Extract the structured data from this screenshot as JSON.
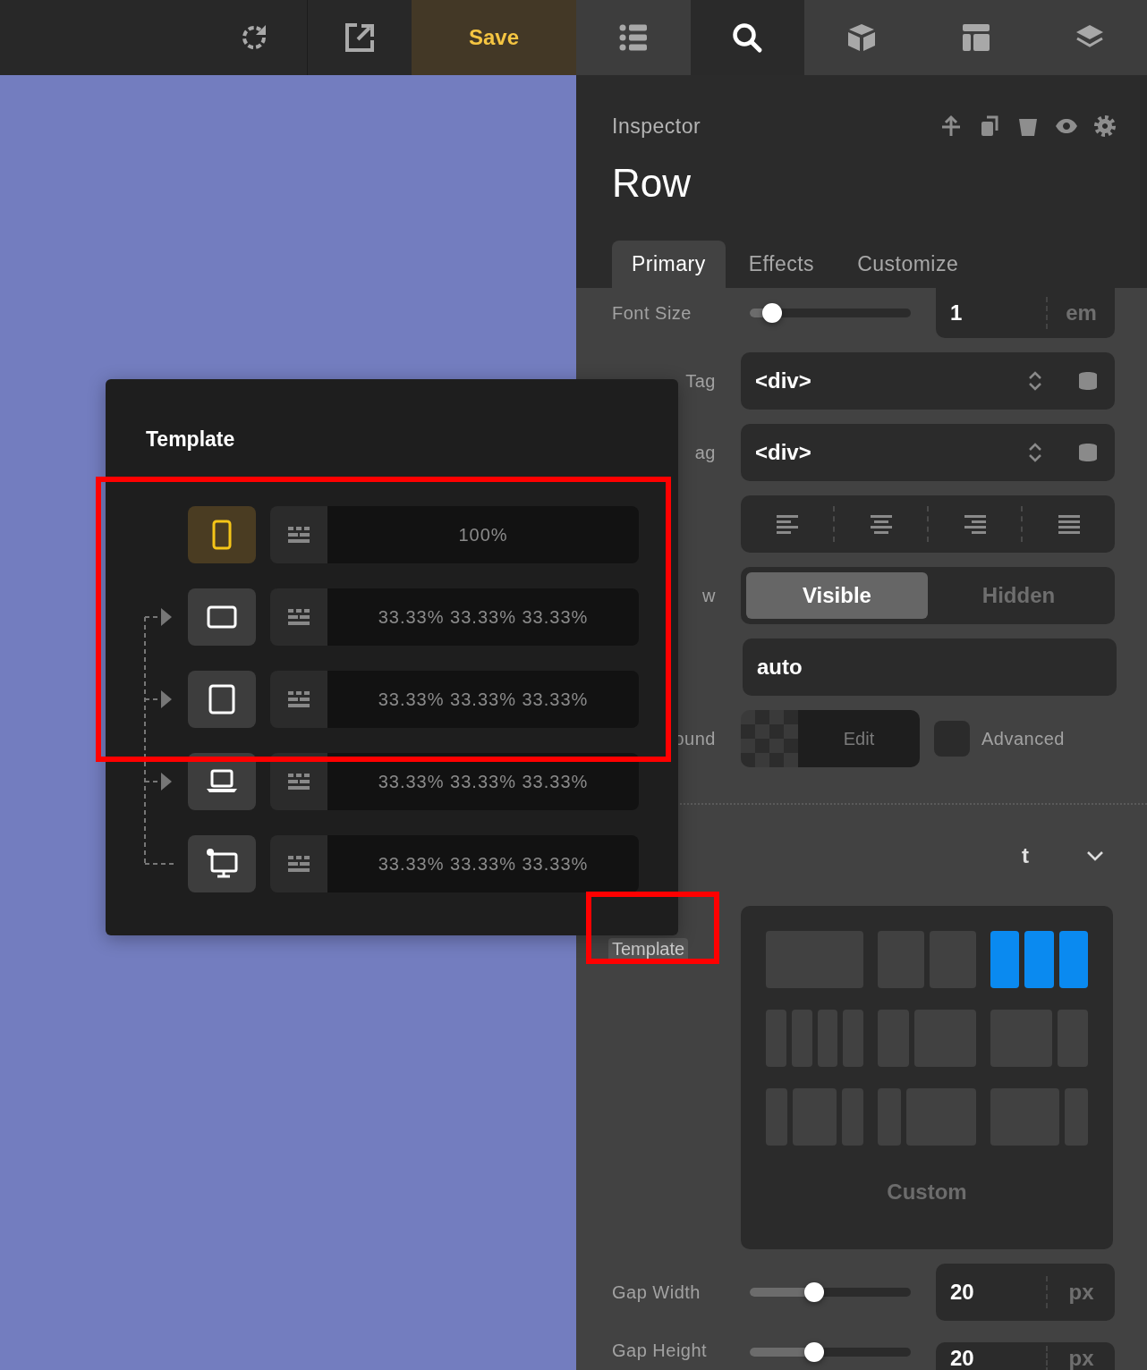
{
  "toolbar": {
    "actions": [
      {
        "kind": "refresh"
      },
      {
        "kind": "export"
      },
      {
        "kind": "save",
        "label": "Save"
      }
    ],
    "tabs": [
      {
        "kind": "list",
        "selected": false
      },
      {
        "kind": "search",
        "selected": true
      },
      {
        "kind": "cube",
        "selected": false
      },
      {
        "kind": "layout",
        "selected": false
      },
      {
        "kind": "layers",
        "selected": false
      }
    ]
  },
  "inspector": {
    "heading": "Inspector",
    "actions": [
      {
        "kind": "move"
      },
      {
        "kind": "copy"
      },
      {
        "kind": "delete"
      },
      {
        "kind": "visibility"
      },
      {
        "kind": "settings"
      }
    ],
    "title": "Row",
    "tabs": [
      {
        "label": "Primary",
        "selected": true
      },
      {
        "label": "Effects",
        "selected": false
      },
      {
        "label": "Customize",
        "selected": false
      }
    ]
  },
  "controls": [
    {
      "kind": "slider",
      "label": "Font Size",
      "clipped": false,
      "level": 0.14,
      "value": "1",
      "unit": "em"
    },
    {
      "kind": "select",
      "label": "Tag",
      "clipped": true,
      "value": "<div>"
    },
    {
      "kind": "select",
      "label": "ag",
      "clipped": true,
      "value": "<div>"
    },
    {
      "kind": "align",
      "options": [
        {
          "kind": "left",
          "selected": false
        },
        {
          "kind": "center",
          "selected": false
        },
        {
          "kind": "right",
          "selected": false
        },
        {
          "kind": "justify",
          "selected": false
        }
      ]
    },
    {
      "kind": "toggle",
      "label": "w",
      "clipped": true,
      "options": [
        {
          "label": "Visible",
          "selected": true
        },
        {
          "label": "Hidden",
          "selected": false
        }
      ]
    },
    {
      "kind": "text",
      "value": "auto"
    },
    {
      "kind": "background",
      "label": "ound",
      "clipped": true,
      "button": "Edit",
      "checkbox": {
        "label": "Advanced",
        "checked": false
      }
    }
  ],
  "section": {
    "title": "t",
    "clipped": true,
    "expanded": true
  },
  "layout": {
    "label": "Template",
    "presets": [
      {
        "kind": "full",
        "selected": false
      },
      {
        "kind": "halves",
        "selected": false
      },
      {
        "kind": "thirds",
        "selected": true
      },
      {
        "kind": "quarters",
        "selected": false
      },
      {
        "kind": "one-two",
        "selected": false
      },
      {
        "kind": "two-one",
        "selected": false
      },
      {
        "kind": "one-two-one",
        "selected": false
      },
      {
        "kind": "one-three",
        "selected": false
      },
      {
        "kind": "three-one",
        "selected": false
      }
    ],
    "custom": "Custom"
  },
  "gaps": [
    {
      "kind": "slider",
      "label": "Gap Width",
      "clipped": false,
      "level": 0.4,
      "value": "20",
      "unit": "px"
    },
    {
      "kind": "slider",
      "label": "Gap Height",
      "clipped": false,
      "level": 0.4,
      "value": "20",
      "unit": "px"
    }
  ],
  "popup": {
    "title": "Template",
    "breakpoints": [
      {
        "kind": "phone",
        "selected": true,
        "value": "100%"
      },
      {
        "kind": "tablet-landscape",
        "selected": false,
        "value": "33.33% 33.33% 33.33%"
      },
      {
        "kind": "tablet-portrait",
        "selected": false,
        "value": "33.33% 33.33% 33.33%"
      },
      {
        "kind": "laptop",
        "selected": false,
        "value": "33.33% 33.33% 33.33%"
      },
      {
        "kind": "desktop",
        "selected": false,
        "value": "33.33% 33.33% 33.33%"
      }
    ]
  },
  "highlights": {
    "breakpoints": true,
    "template_label": true
  }
}
